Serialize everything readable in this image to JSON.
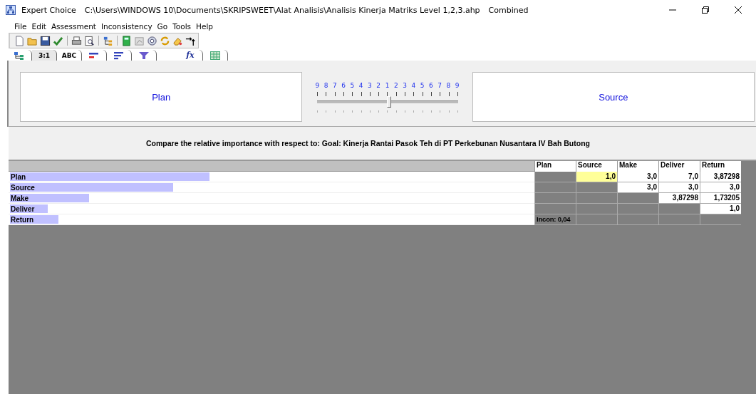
{
  "window": {
    "app": "Expert Choice",
    "path": "C:\\Users\\WINDOWS 10\\Documents\\SKRIPSWEET\\Alat Analisis\\Analisis Kinerja Matriks Level 1,2,3.ahp",
    "mode": "Combined"
  },
  "menu": [
    "File",
    "Edit",
    "Assessment",
    "Inconsistency",
    "Go",
    "Tools",
    "Help"
  ],
  "tabs": [
    {
      "kind": "tree",
      "selected": false
    },
    {
      "kind": "text",
      "label": "3:1",
      "selected": true
    },
    {
      "kind": "text",
      "label": "ABC",
      "selected": false
    },
    {
      "kind": "redbars",
      "selected": false
    },
    {
      "kind": "bluebars",
      "selected": false
    },
    {
      "kind": "funnel",
      "selected": false
    },
    {
      "kind": "fx",
      "label": "fx",
      "selected": false
    },
    {
      "kind": "grid",
      "selected": false
    }
  ],
  "compare": {
    "left": "Plan",
    "right": "Source",
    "scale": [
      "9",
      "8",
      "7",
      "6",
      "5",
      "4",
      "3",
      "2",
      "1",
      "2",
      "3",
      "4",
      "5",
      "6",
      "7",
      "8",
      "9"
    ],
    "level": 0.515,
    "prompt": "Compare the relative importance with respect to: Goal: Kinerja Rantai Pasok Teh di PT Perkebunan Nusantara IV Bah Butong"
  },
  "matrix": {
    "columns": [
      "Plan",
      "Source",
      "Make",
      "Deliver",
      "Return"
    ],
    "rows": [
      {
        "name": "Plan",
        "level": 0.38,
        "cells": [
          {
            "kind": "gray"
          },
          {
            "kind": "value",
            "text": "1,0",
            "selected": true
          },
          {
            "kind": "value",
            "text": "3,0",
            "selected": false
          },
          {
            "kind": "value",
            "text": "7,0",
            "selected": false
          },
          {
            "kind": "value",
            "text": "3,87298",
            "selected": false
          }
        ]
      },
      {
        "name": "Source",
        "level": 0.31,
        "cells": [
          {
            "kind": "gray"
          },
          {
            "kind": "gray"
          },
          {
            "kind": "value",
            "text": "3,0",
            "selected": false
          },
          {
            "kind": "value",
            "text": "3,0",
            "selected": false
          },
          {
            "kind": "value",
            "text": "3,0",
            "selected": false
          }
        ]
      },
      {
        "name": "Make",
        "level": 0.151,
        "cells": [
          {
            "kind": "gray"
          },
          {
            "kind": "gray"
          },
          {
            "kind": "gray"
          },
          {
            "kind": "value",
            "text": "3,87298",
            "selected": false
          },
          {
            "kind": "value",
            "text": "1,73205",
            "selected": false
          }
        ]
      },
      {
        "name": "Deliver",
        "level": 0.072,
        "cells": [
          {
            "kind": "gray"
          },
          {
            "kind": "gray"
          },
          {
            "kind": "gray"
          },
          {
            "kind": "gray"
          },
          {
            "kind": "value",
            "text": "1,0",
            "selected": false
          }
        ]
      },
      {
        "name": "Return",
        "level": 0.092,
        "cells": [
          {
            "kind": "note",
            "text": "Incon: 0,04"
          },
          {
            "kind": "gray"
          },
          {
            "kind": "gray"
          },
          {
            "kind": "gray"
          },
          {
            "kind": "gray"
          }
        ]
      }
    ]
  }
}
